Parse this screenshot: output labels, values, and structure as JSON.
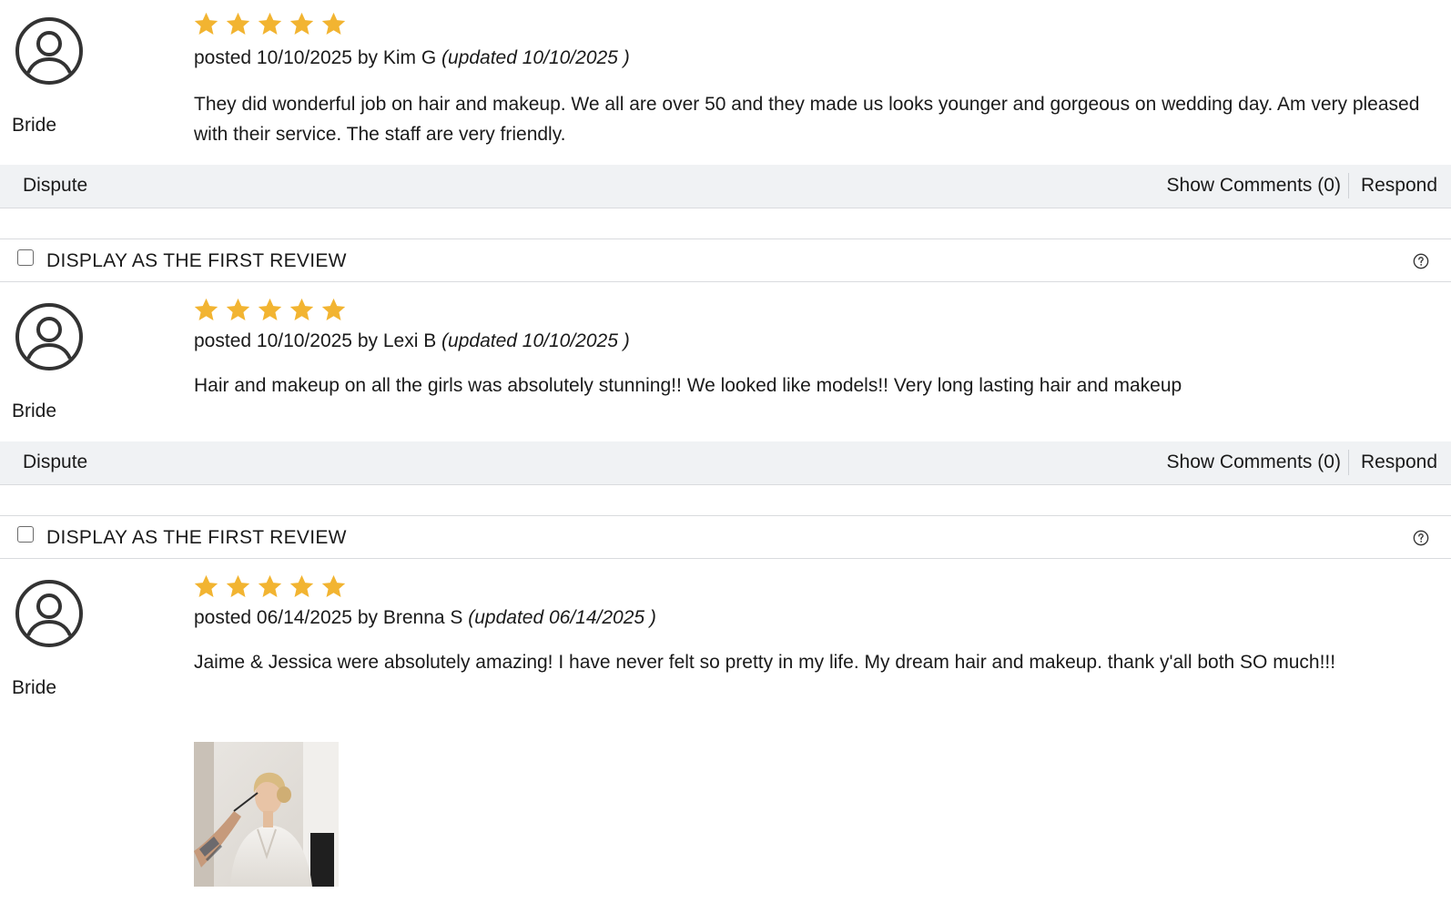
{
  "colors": {
    "star": "#f2b431",
    "action_bar_bg": "#f0f2f4",
    "divider": "#d9dbde",
    "text": "#1a1a1a"
  },
  "first_review_label": "DISPLAY AS THE FIRST REVIEW",
  "reviews": [
    {
      "rating": 5,
      "posted_prefix": "posted 10/10/2025 by Kim G",
      "updated_text": "(updated 10/10/2025 )",
      "role": "Bride",
      "body": "They did wonderful job on hair and makeup. We all are over 50 and they made us looks younger and gorgeous on wedding day.  Am very pleased with their service. The staff are very friendly.",
      "dispute_label": "Dispute",
      "show_comments_label": "Show Comments (0)",
      "respond_label": "Respond"
    },
    {
      "rating": 5,
      "posted_prefix": "posted 10/10/2025 by Lexi B",
      "updated_text": "(updated 10/10/2025 )",
      "role": "Bride",
      "body": "Hair and makeup on all the girls was absolutely stunning!! We looked like models!! Very long lasting hair and makeup",
      "dispute_label": "Dispute",
      "show_comments_label": "Show Comments (0)",
      "respond_label": "Respond"
    },
    {
      "rating": 5,
      "posted_prefix": "posted 06/14/2025 by Brenna S",
      "updated_text": "(updated 06/14/2025 )",
      "role": "Bride",
      "body": "Jaime & Jessica were absolutely amazing! I have never felt so pretty in my life. My dream hair and makeup. thank y'all both SO much!!!"
    }
  ]
}
